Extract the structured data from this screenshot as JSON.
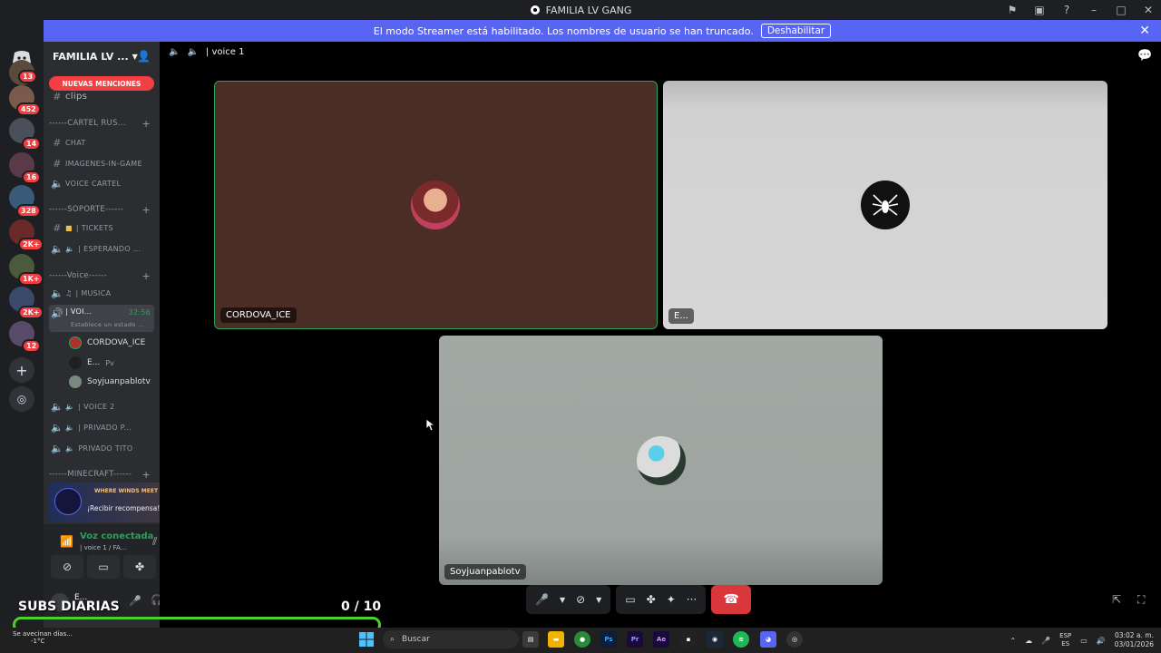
{
  "window": {
    "title": "FAMILIA LV GANG"
  },
  "banner": {
    "text": "El modo Streamer está habilitado. Los nombres de usuario se han truncado.",
    "button": "Deshabilitar"
  },
  "guild_badges": [
    "13",
    "452",
    "14",
    "16",
    "328",
    "2K+",
    "1K+",
    "2K+",
    "12"
  ],
  "server": {
    "name": "FAMILIA LV ..."
  },
  "mentions_pill": "NUEVAS MENCIONES",
  "channels": {
    "clips": "clips",
    "cat_cartel": "------CARTEL RUS...",
    "chat": "CHAT",
    "imagenes": "IMAGENES-IN-GAME",
    "voice_cartel": "VOICE CARTEL",
    "cat_soporte": "------SOPORTE------",
    "tickets": "| TICKETS",
    "esperando": "| ESPERANDO ...",
    "cat_voice": "------Voice------",
    "musica": "| MUSICA",
    "active_voice": "| VOI...",
    "active_time": "32:56",
    "active_status": "Establece un estado ...",
    "voice2": "| VOICE 2",
    "privado_p": "| PRIVADO P...",
    "privado_tito": "PRIVADO TITO",
    "cat_minecraft": "------MINECRAFT------"
  },
  "voice_users": [
    "CORDOVA_ICE",
    "E...",
    "Soyjuanpablotv"
  ],
  "voice_user_tag": "Pv",
  "promo": {
    "text": "¡Recibir recompensa!",
    "logo": "WHERE WINDS MEET"
  },
  "voice_status": {
    "title": "Voz conectada",
    "subtitle": "| voice 1 / FA..."
  },
  "user": {
    "name": "E..."
  },
  "channel_header": "| voice 1",
  "tiles": [
    {
      "name": "CORDOVA_ICE"
    },
    {
      "name": "E..."
    },
    {
      "name": "Soyjuanpablotv"
    }
  ],
  "overlay": {
    "title": "SUBS DIARIAS",
    "count": "0 / 10",
    "progress": 0
  },
  "taskbar": {
    "weather_text": "Se avecinan días...",
    "weather_temp": "-1°C",
    "search": "Buscar",
    "lang_top": "ESP",
    "lang_bottom": "ES",
    "time": "03:02 a. m.",
    "date": "03/01/2026"
  },
  "colors": {
    "accent": "#5865f2",
    "connected": "#23a55a",
    "danger": "#da373c",
    "progress": "#4cd12a"
  }
}
